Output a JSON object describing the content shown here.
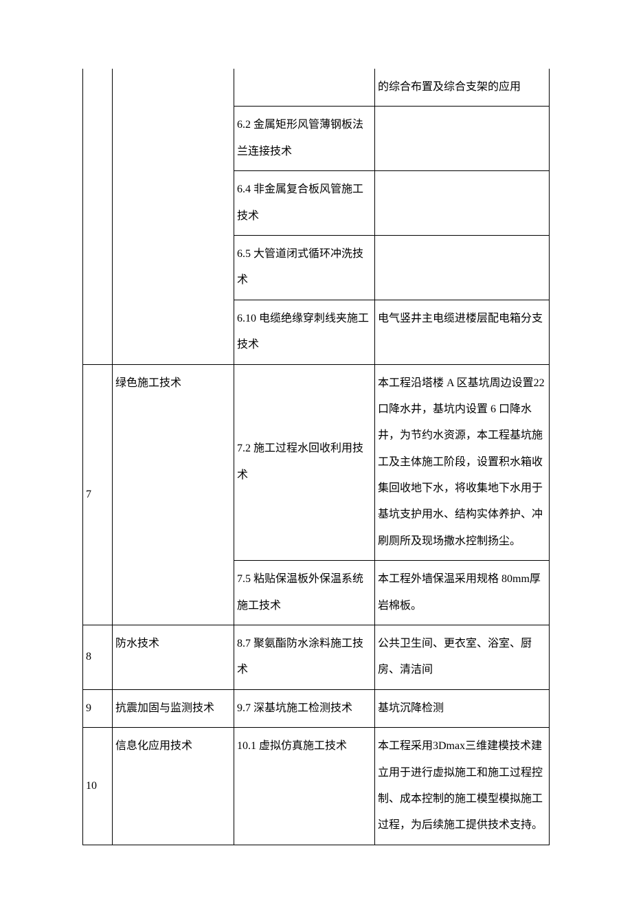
{
  "rows": [
    {
      "num": "",
      "cat": "",
      "tech": "",
      "desc": "的综合布置及综合支架的应用",
      "open_top": true
    },
    {
      "num": "",
      "cat": "",
      "tech": "6.2 金属矩形风管薄钢板法兰连接技术",
      "desc": ""
    },
    {
      "num": "",
      "cat": "",
      "tech": "6.4 非金属复合板风管施工技术",
      "desc": ""
    },
    {
      "num": "",
      "cat": "",
      "tech": "6.5 大管道闭式循环冲洗技术",
      "desc": ""
    },
    {
      "num": "",
      "cat": "",
      "tech": "6.10 电缆绝缘穿刺线夹施工技术",
      "desc": "电气竖井主电缆进楼层配电箱分支"
    },
    {
      "num": "7",
      "cat": "绿色施工技术",
      "tech": "7.2 施工过程水回收利用技术",
      "desc": "本工程沿塔楼 A 区基坑周边设置22 口降水井，基坑内设置 6 口降水井，为节约水资源，本工程基坑施工及主体施工阶段，设置积水箱收集回收地下水，将收集地下水用于基坑支护用水、结构实体养护、冲刷厕所及现场撒水控制扬尘。",
      "rowspan_numcat": 2
    },
    {
      "num": "",
      "cat": "",
      "tech": "7.5 粘贴保温板外保温系统施工技术",
      "desc": "本工程外墙保温采用规格 80mm厚岩棉板。"
    },
    {
      "num": "8",
      "cat": "防水技术",
      "tech": "8.7 聚氨酯防水涂料施工技术",
      "desc": "公共卫生间、更衣室、浴室、厨房、清洁间"
    },
    {
      "num": "9",
      "cat": "抗震加固与监测技术",
      "tech": "9.7 深基坑施工检测技术",
      "desc": "基坑沉降检测"
    },
    {
      "num": "10",
      "cat": "信息化应用技术",
      "tech": "10.1 虚拟仿真施工技术",
      "desc": "本工程采用3Dmax三维建模技术建立用于进行虚拟施工和施工过程控制、成本控制的施工模型模拟施工过程，为后续施工提供技术支持。"
    }
  ]
}
